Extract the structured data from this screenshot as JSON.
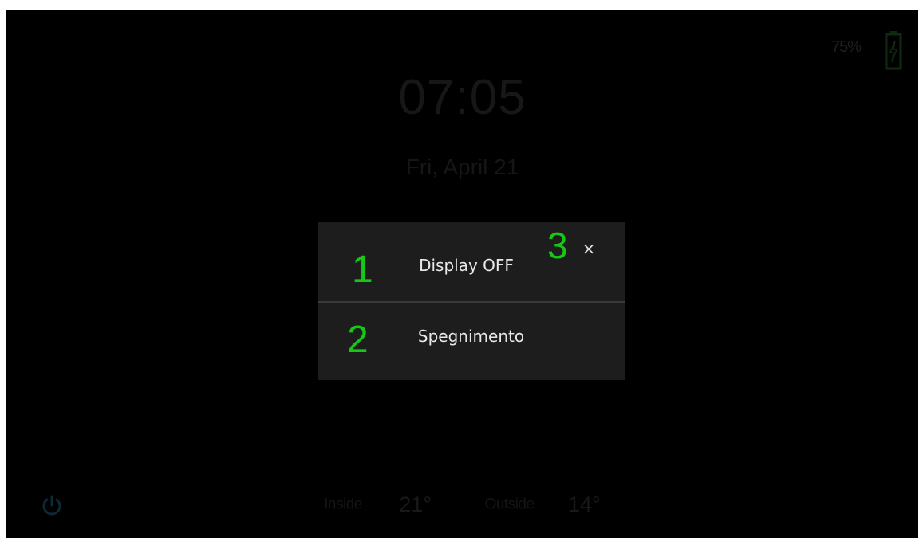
{
  "status": {
    "battery_percent": "75%"
  },
  "clock": {
    "time": "07:05",
    "date": "Fri, April 21"
  },
  "dialog": {
    "items": [
      {
        "label": "Display OFF",
        "marker": "1"
      },
      {
        "label": "Spegnimento",
        "marker": "2"
      }
    ],
    "close_marker": "3",
    "close_glyph": "×"
  },
  "footer": {
    "inside_label": "Inside",
    "inside_value": "21°",
    "outside_label": "Outside",
    "outside_value": "14°"
  },
  "icons": {
    "battery": "battery-charging-icon",
    "power": "power-icon",
    "close": "close-icon"
  },
  "colors": {
    "background": "#000000",
    "dialog_bg": "#1d1d1d",
    "marker_green": "#14c814",
    "battery_green": "#0f2a0f",
    "power_blue": "#0c2a36"
  }
}
